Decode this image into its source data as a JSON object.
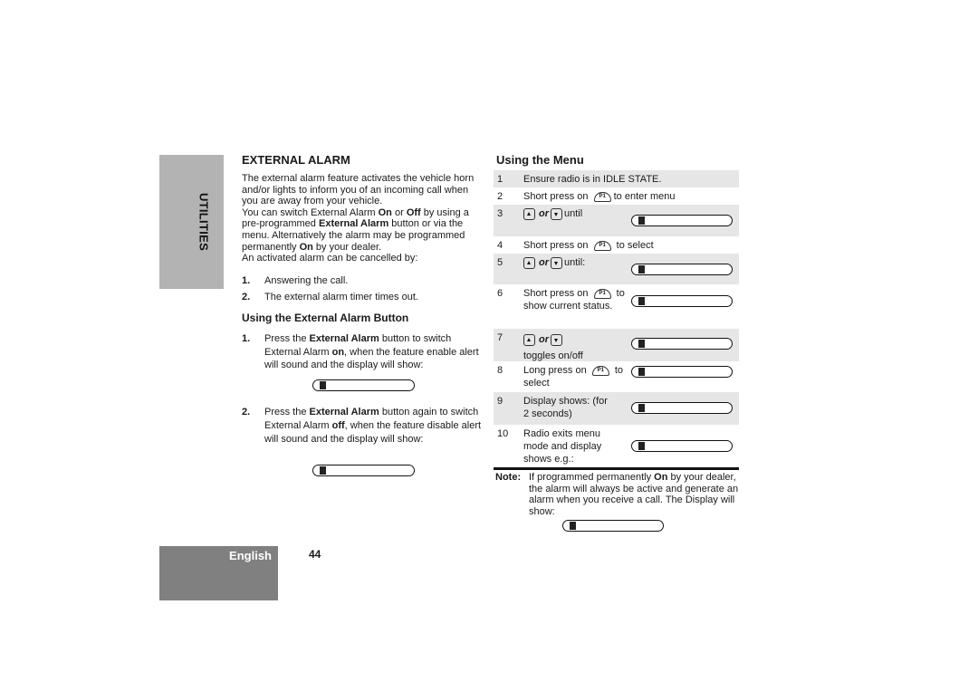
{
  "side_tab": {
    "label": "UTILITIES"
  },
  "footer": {
    "language": "English",
    "page_number": "44"
  },
  "section": {
    "title": "EXTERNAL ALARM",
    "intro_1": "The external alarm feature activates the vehicle horn and/or lights to inform you of an incoming call when you are away from your vehicle.",
    "intro_2a": "You can switch  External Alarm ",
    "intro_2b": "On",
    "intro_2c": " or ",
    "intro_2d": "Off",
    "intro_2e": " by using a pre-programmed ",
    "intro_2f": "External Alarm",
    "intro_2g": " button or via the menu. Alternatively the alarm may be programmed permanently ",
    "intro_2h": "On",
    "intro_2i": " by your dealer.",
    "intro_3": "An activated alarm can be cancelled by:",
    "cancel_list": [
      {
        "num": "1.",
        "text": "Answering the call."
      },
      {
        "num": "2.",
        "text": "The external alarm timer times out."
      }
    ]
  },
  "button_section": {
    "title": "Using the External Alarm Button",
    "steps": [
      {
        "num": "1.",
        "a": "Press the ",
        "b": "External Alarm",
        "c": " button to switch External Alarm ",
        "d": "on",
        "e": ", when the feature enable alert will sound and the display will show:",
        "display_icon": "alarm-on-icon"
      },
      {
        "num": "2.",
        "a": "Press the ",
        "b": "External Alarm",
        "c": " button again to switch External Alarm ",
        "d": "off",
        "e": ", when the feature disable alert will sound and the display will show:",
        "display_icon": "alarm-off-icon"
      }
    ]
  },
  "menu_section": {
    "title": "Using the Menu",
    "or_label": "or",
    "p1_label": "P1",
    "rows": [
      {
        "num": "1",
        "text": "Ensure radio is in IDLE STATE."
      },
      {
        "num": "2",
        "pre": "Short press on",
        "post": "to enter menu"
      },
      {
        "num": "3",
        "post": "until",
        "display_icon": "utilities-menu-icon"
      },
      {
        "num": "4",
        "pre": "Short press on",
        "post": "to select"
      },
      {
        "num": "5",
        "post": "until:",
        "display_icon": "ext-alarm-menu-icon"
      },
      {
        "num": "6",
        "pre": "Short press on",
        "post": "to show current status.",
        "display_icon": "status-icon"
      },
      {
        "num": "7",
        "post": "toggles on/off",
        "display_icon": "toggle-icon"
      },
      {
        "num": "8",
        "pre": "Long press on",
        "post": "to select",
        "display_icon": "select-icon"
      },
      {
        "num": "9",
        "text": "Display shows: (for 2 seconds)",
        "display_icon": "confirm-icon"
      },
      {
        "num": "10",
        "text": "Radio exits menu mode and display shows e.g.:",
        "display_icon": "idle-icon"
      }
    ]
  },
  "note": {
    "label": "Note:",
    "a": "If programmed permanently ",
    "b": "On",
    "c": " by your dealer, the alarm will always be active and generate an alarm when you receive a call. The Display will show:",
    "display_icon": "permanent-alarm-icon"
  }
}
